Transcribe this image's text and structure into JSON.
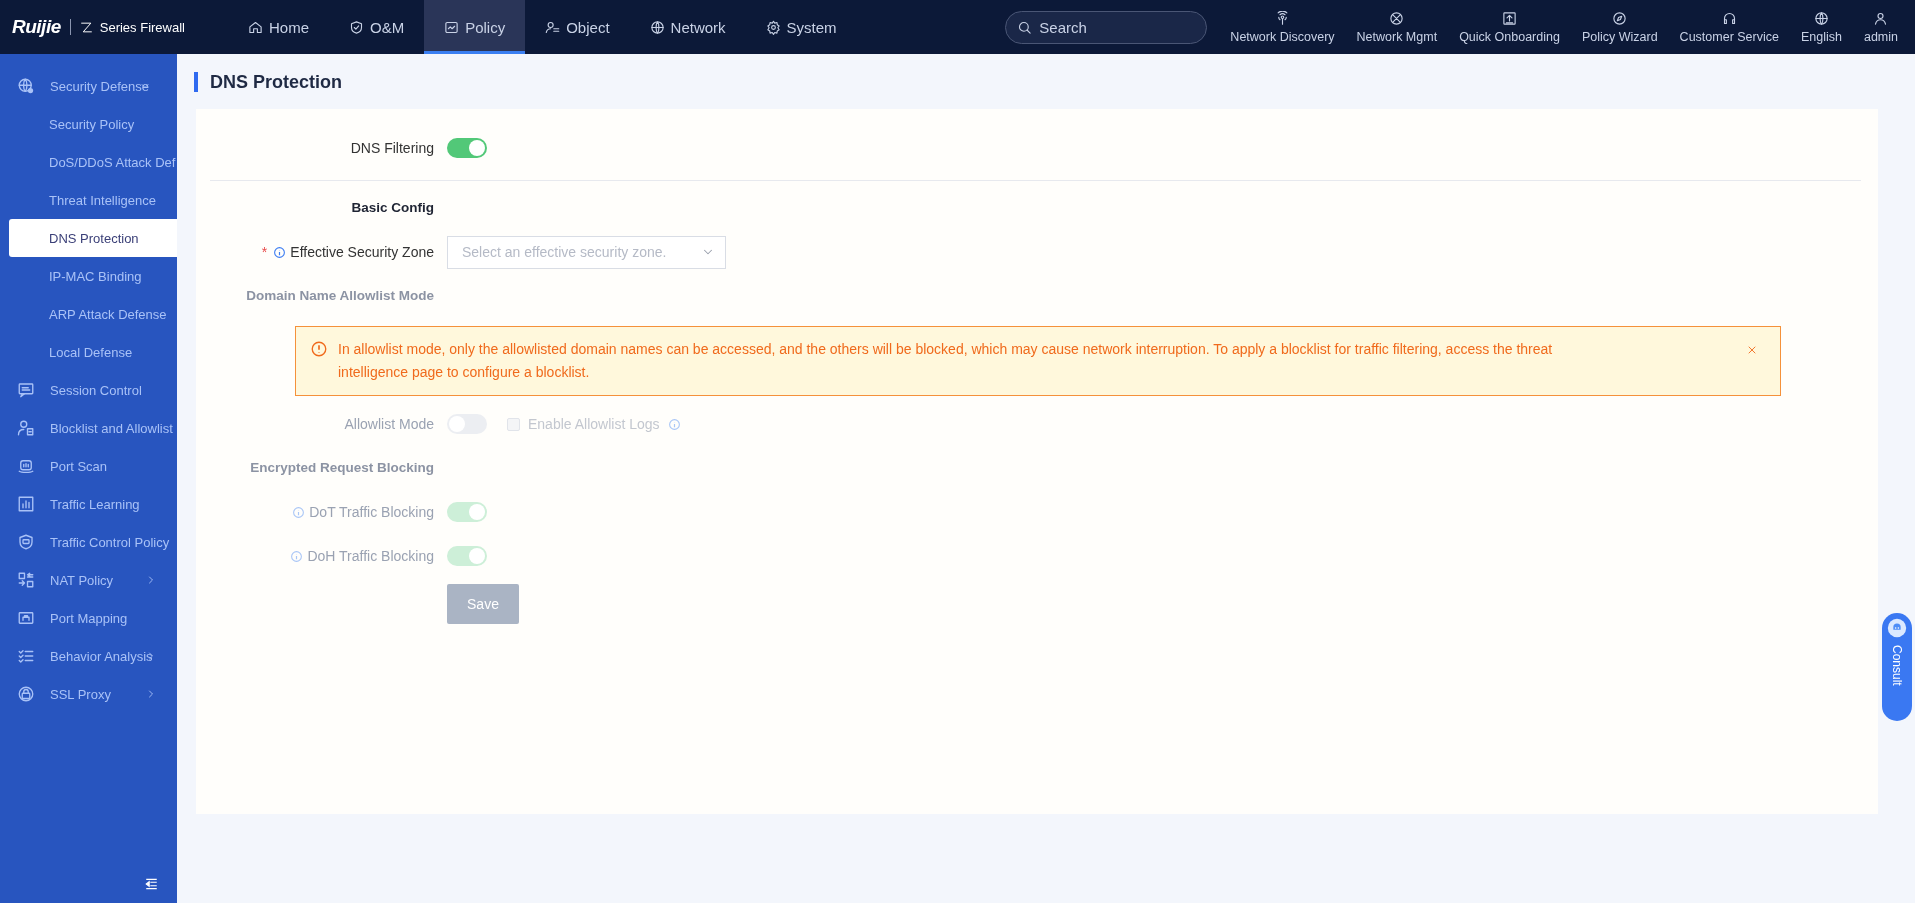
{
  "topbar": {
    "logo": "Ruijie",
    "product": "Series Firewall",
    "nav": [
      {
        "label": "Home",
        "selected": false
      },
      {
        "label": "O&M",
        "selected": false
      },
      {
        "label": "Policy",
        "selected": true
      },
      {
        "label": "Object",
        "selected": false
      },
      {
        "label": "Network",
        "selected": false
      },
      {
        "label": "System",
        "selected": false
      }
    ],
    "search": {
      "placeholder": "Search"
    },
    "tools": [
      {
        "label": "Network Discovery"
      },
      {
        "label": "Network Mgmt"
      },
      {
        "label": "Quick Onboarding"
      },
      {
        "label": "Policy Wizard"
      },
      {
        "label": "Customer Service"
      },
      {
        "label": "English"
      },
      {
        "label": "admin"
      }
    ]
  },
  "sidebar": {
    "items": [
      {
        "label": "Security Defense",
        "expanded": true,
        "children": [
          {
            "label": "Security Policy",
            "selected": false
          },
          {
            "label": "DoS/DDoS Attack Def",
            "selected": false
          },
          {
            "label": "Threat Intelligence",
            "selected": false
          },
          {
            "label": "DNS Protection",
            "selected": true
          },
          {
            "label": "IP-MAC Binding",
            "selected": false
          },
          {
            "label": "ARP Attack Defense",
            "selected": false
          },
          {
            "label": "Local Defense",
            "selected": false
          }
        ]
      },
      {
        "label": "Session Control"
      },
      {
        "label": "Blocklist and Allowlist"
      },
      {
        "label": "Port Scan"
      },
      {
        "label": "Traffic Learning"
      },
      {
        "label": "Traffic Control Policy"
      },
      {
        "label": "NAT Policy",
        "expanded": false
      },
      {
        "label": "Port Mapping"
      },
      {
        "label": "Behavior Analysis",
        "expanded": false
      },
      {
        "label": "SSL Proxy",
        "expanded": false
      }
    ]
  },
  "page": {
    "title": "DNS Protection"
  },
  "form": {
    "rows": [
      {
        "kind": "switch",
        "label": "DNS Filtering",
        "on": true,
        "disabled": false
      },
      {
        "kind": "divider"
      },
      {
        "kind": "heading",
        "label": "Basic Config",
        "disabled": false
      },
      {
        "kind": "select",
        "label": "Effective Security Zone",
        "required_mark": "*",
        "info": true,
        "placeholder": "Select an effective security zone."
      },
      {
        "kind": "heading",
        "label": "Domain Name Allowlist Mode",
        "disabled": true
      },
      {
        "kind": "alert",
        "text": "In allowlist mode, only the allowlisted domain names can be accessed, and the others will be blocked, which may cause network interruption. To apply a blocklist for traffic filtering, access the threat intelligence page to configure a blocklist.",
        "closable": true
      },
      {
        "kind": "switch",
        "label": "Allowlist Mode",
        "on": false,
        "disabled": true,
        "checkbox": {
          "label": "Enable Allowlist Logs",
          "checked": false,
          "disabled": true,
          "info": true
        }
      },
      {
        "kind": "heading",
        "label": "Encrypted Request Blocking",
        "disabled": true
      },
      {
        "kind": "switch",
        "label": "DoT Traffic Blocking",
        "info": true,
        "on": true,
        "disabled": true
      },
      {
        "kind": "switch",
        "label": "DoH Traffic Blocking",
        "info": true,
        "on": true,
        "disabled": true
      },
      {
        "kind": "button",
        "label": "Save",
        "disabled": true
      }
    ]
  },
  "consult": {
    "label": "Consult"
  }
}
